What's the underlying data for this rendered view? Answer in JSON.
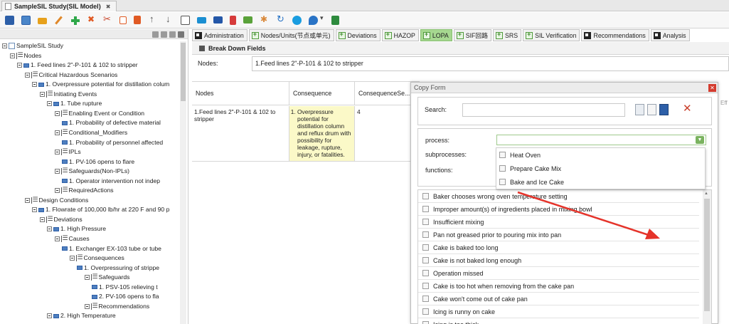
{
  "window": {
    "title": "SampleSIL Study(SIL Model)",
    "close": "✖"
  },
  "toolbar": {
    "icons": [
      "save-icon",
      "save-all-icon",
      "open-folder-icon",
      "edit-icon",
      "add-icon",
      "delete-icon",
      "cut-icon",
      "copy-icon",
      "paste-icon",
      "move-up-icon",
      "move-down-icon",
      "move-icon",
      "view-icon",
      "worksheet-icon",
      "flag-icon",
      "chart-icon",
      "settings-icon",
      "refresh-icon",
      "skype-icon",
      "location-icon",
      "dropdown-caret-icon",
      "excel-export-icon"
    ]
  },
  "tree": {
    "items": [
      {
        "label": "SampleSIL Study",
        "indent": 0,
        "icon": "doc"
      },
      {
        "label": "Nodes",
        "indent": 1,
        "icon": "grp"
      },
      {
        "label": "1. Feed lines 2\"-P-101 & 102 to stripper",
        "indent": 2,
        "icon": "item"
      },
      {
        "label": "Critical Hazardous Scenarios",
        "indent": 3,
        "icon": "grp"
      },
      {
        "label": "1. Overpressure potential for distillation colum",
        "indent": 4,
        "icon": "item"
      },
      {
        "label": "Initiating Events",
        "indent": 5,
        "icon": "grp"
      },
      {
        "label": "1. Tube rupture",
        "indent": 6,
        "icon": "item"
      },
      {
        "label": "Enabling Event or Condition",
        "indent": 7,
        "icon": "grp"
      },
      {
        "label": "1. Probability of defective material",
        "indent": 8,
        "icon": "item"
      },
      {
        "label": "Conditional_Modifiers",
        "indent": 7,
        "icon": "grp"
      },
      {
        "label": "1. Probability of personnel affected",
        "indent": 8,
        "icon": "item"
      },
      {
        "label": "IPLs",
        "indent": 7,
        "icon": "grp"
      },
      {
        "label": "1. PV-106 opens to flare",
        "indent": 8,
        "icon": "item"
      },
      {
        "label": "Safeguards(Non-IPLs)",
        "indent": 7,
        "icon": "grp"
      },
      {
        "label": "1. Operator intervention not indep",
        "indent": 8,
        "icon": "item"
      },
      {
        "label": "RequiredActions",
        "indent": 7,
        "icon": "grp"
      },
      {
        "label": "Design Conditions",
        "indent": 3,
        "icon": "grp"
      },
      {
        "label": "1. Flowrate of 100,000 lb/hr at 220 F and 90 p",
        "indent": 4,
        "icon": "item"
      },
      {
        "label": "Deviations",
        "indent": 5,
        "icon": "grp"
      },
      {
        "label": "1. High Pressure",
        "indent": 6,
        "icon": "item"
      },
      {
        "label": "Causes",
        "indent": 7,
        "icon": "grp"
      },
      {
        "label": "1. Exchanger EX-103 tube or tube",
        "indent": 8,
        "icon": "item"
      },
      {
        "label": "Consequences",
        "indent": 9,
        "icon": "grp"
      },
      {
        "label": "1. Overpressuring of strippe",
        "indent": 10,
        "icon": "item"
      },
      {
        "label": "Safeguards",
        "indent": 11,
        "icon": "grp"
      },
      {
        "label": "1. PSV-105 relieving t",
        "indent": 12,
        "icon": "item"
      },
      {
        "label": "2. PV-106 opens to fla",
        "indent": 12,
        "icon": "item"
      },
      {
        "label": "Recommendations",
        "indent": 11,
        "icon": "grp"
      },
      {
        "label": "2. High Temperature",
        "indent": 6,
        "icon": "item"
      }
    ]
  },
  "tabs": [
    {
      "label": "Administration",
      "icon": "dark",
      "active": false
    },
    {
      "label": "Nodes/Units(节点或单元)",
      "icon": "green",
      "active": false
    },
    {
      "label": "Deviations",
      "icon": "green",
      "active": false
    },
    {
      "label": "HAZOP",
      "icon": "green",
      "active": false
    },
    {
      "label": "LOPA",
      "icon": "green",
      "active": true
    },
    {
      "label": "SIF回路",
      "icon": "green",
      "active": false
    },
    {
      "label": "SRS",
      "icon": "green",
      "active": false
    },
    {
      "label": "SIL Verification",
      "icon": "green",
      "active": false
    },
    {
      "label": "Recommendations",
      "icon": "dark",
      "active": false
    },
    {
      "label": "Analysis",
      "icon": "dark",
      "active": false
    }
  ],
  "breakdown": {
    "title": "Break Down Fields",
    "nodes_label": "Nodes:",
    "nodes_value": "1.Feed lines 2\"-P-101 & 102  to stripper"
  },
  "grid": {
    "headers": [
      "Nodes",
      "Consequence",
      "ConsequenceSe..."
    ],
    "row": {
      "nodes": "1.Feed lines 2\"-P-101 & 102 to stripper",
      "consequence": "Overpressure potential for distillation column and reflux drum with possibility for leakage, rupture, injury, or fatalities.",
      "severity": "4"
    }
  },
  "dialog": {
    "title": "Copy Form",
    "search_label": "Search:",
    "search_value": "",
    "process_label": "process:",
    "subprocesses_label": "subprocesses:",
    "functions_label": "functions:",
    "process_options": [
      "Heat Oven",
      "Prepare Cake Mix",
      "Bake and Ice Cake"
    ],
    "items": [
      "Baker chooses wrong oven temperature setting",
      "Improper amount(s) of ingredients placed in mixing bowl",
      "Insufficient mixing",
      "Pan not greased prior to pouring mix into pan",
      "Cake is baked too long",
      "Cake is not baked long enough",
      "Operation missed",
      "Cake is too hot when removing from the cake pan",
      "Cake won't come out of cake pan",
      "Icing is runny on cake",
      "Icing is too thick"
    ]
  },
  "annotation": {
    "arrow_color": "#e5332a"
  }
}
